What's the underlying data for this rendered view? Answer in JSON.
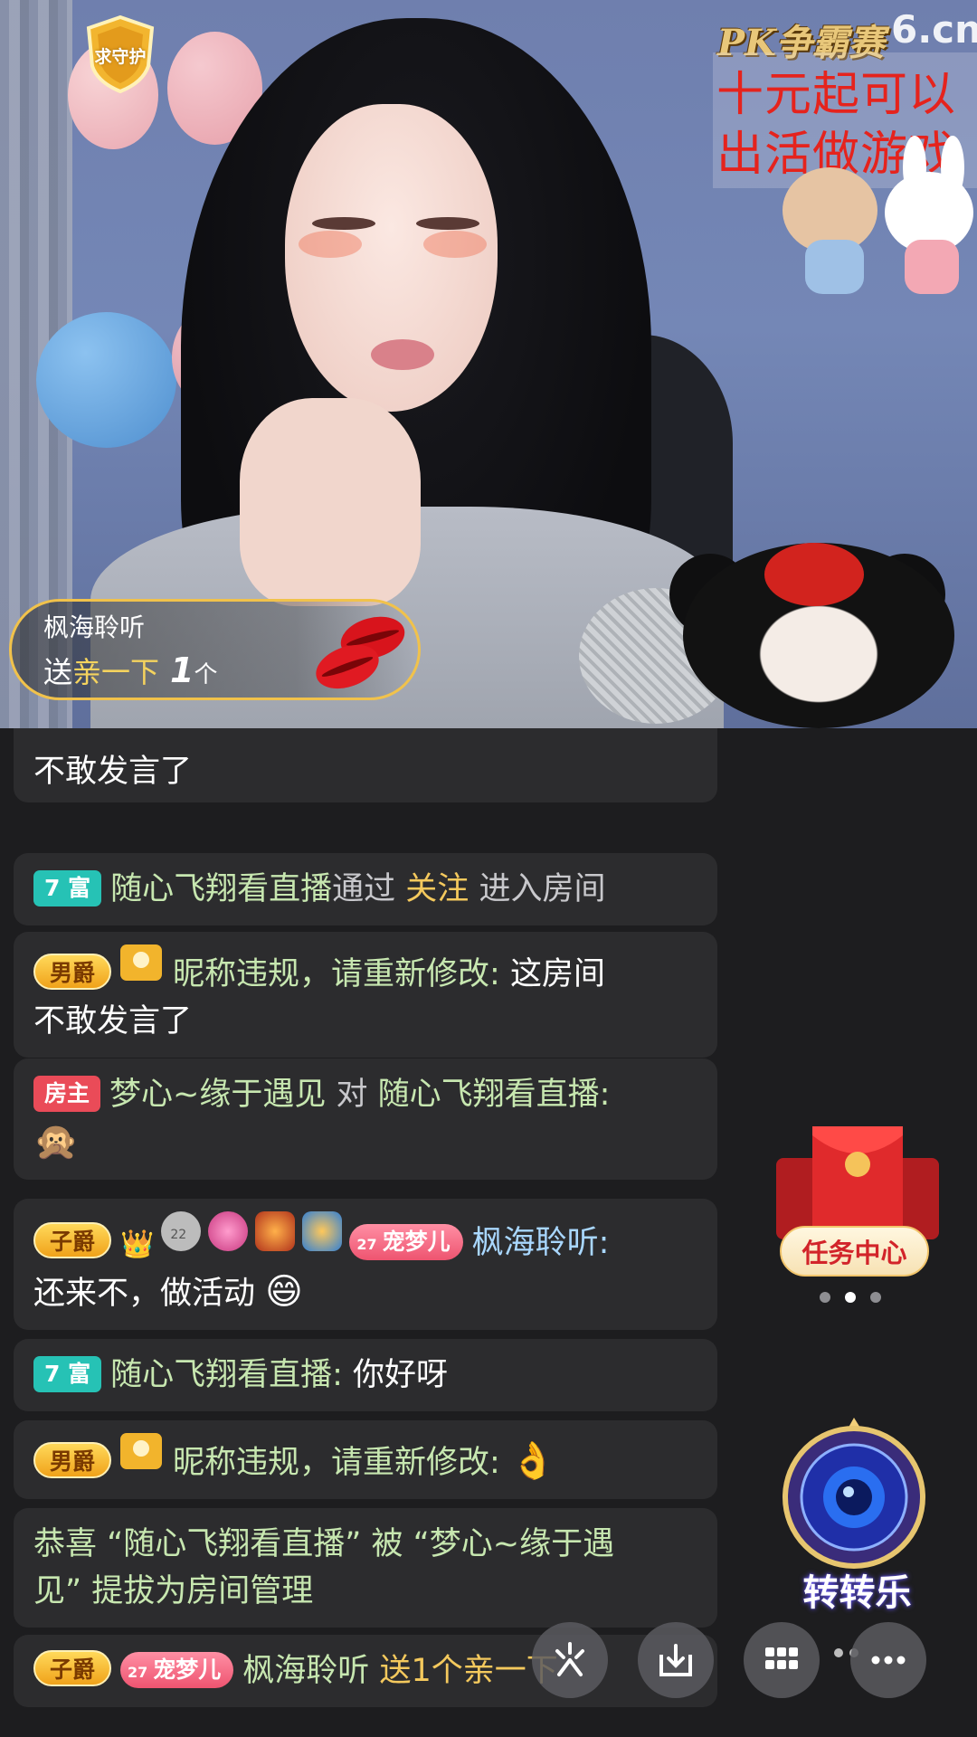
{
  "video": {
    "guard_badge": "求守护",
    "pk_logo": "PK争霸赛",
    "site_logo": "6.cn",
    "promo_line1": "十元起可以",
    "promo_line2": "出活做游戏"
  },
  "gift_toast": {
    "user": "枫海聆听",
    "send_word": "送",
    "gift_name": "亲一下",
    "count": "1",
    "unit": "个"
  },
  "chat": [
    {
      "tail": "不敢发言了"
    },
    {
      "rich_level": "7 富",
      "user": "随心飞翔看直播",
      "via": "通过",
      "action": "关注",
      "enter": "进入房间"
    },
    {
      "noble": "男爵",
      "user": "昵称违规，请重新修改:",
      "text1": "这房间",
      "text2": "不敢发言了"
    },
    {
      "host_tag": "房主",
      "user": "梦心~缘于遇见",
      "to": "对",
      "target": "随心飞翔看直播:",
      "emoji": "🙊"
    },
    {
      "noble": "子爵",
      "badge_level": "22",
      "pet_level": "27",
      "pet_name": "宠梦儿",
      "user": "枫海聆听:",
      "text": "还来不，做活动",
      "emoji": "😄"
    },
    {
      "rich_level": "7 富",
      "user": "随心飞翔看直播:",
      "text": "你好呀"
    },
    {
      "noble": "男爵",
      "user": "昵称违规，请重新修改:",
      "emoji": "👌"
    },
    {
      "line1": "恭喜 “随心飞翔看直播” 被 “梦心~缘于遇",
      "line2": "见” 提拔为房间管理"
    },
    {
      "noble": "子爵",
      "pet_level": "27",
      "pet_name": "宠梦儿",
      "user": "枫海聆听",
      "action": "送1个亲一下"
    }
  ],
  "widgets": {
    "task_center": "任务中心",
    "wheel_label": "转转乐",
    "carousel_active_index": 1
  },
  "toolbar": [
    "share-icon",
    "download-icon",
    "grid-icon",
    "more-icon"
  ],
  "colors": {
    "accent_gold": "#f1c24b",
    "rich_tag": "#26c2b5",
    "host_tag": "#ea4b58",
    "nick_green": "#c7e7b0",
    "nick_blue": "#a9d7ff",
    "highlight_yellow": "#f4c95d"
  }
}
